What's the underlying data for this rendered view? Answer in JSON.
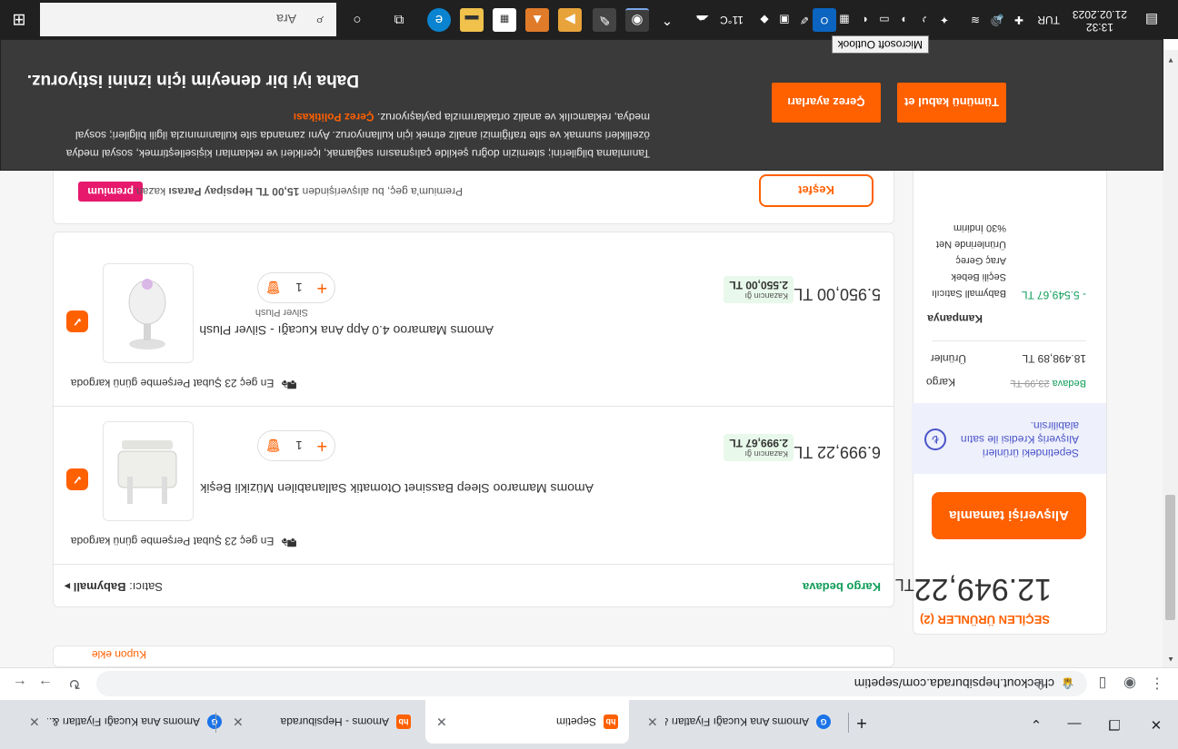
{
  "browser": {
    "tabs": [
      {
        "title": "Amoms Ana Kucağı Fiyatları &...",
        "favicon": "google-icon",
        "active": false
      },
      {
        "title": "Amoms - Hepsiburada",
        "favicon": "hb",
        "active": false
      },
      {
        "title": "Sepetim",
        "favicon": "hb",
        "active": true
      },
      {
        "title": "Amoms Ana Kucağı Fiyatları &...",
        "favicon": "google-icon",
        "active": false
      }
    ],
    "favicon_hb_text": "hb",
    "close_glyph": "✕",
    "new_tab_glyph": "+",
    "url": "checkout.hepsiburada.com/sepetim"
  },
  "cart": {
    "summary": {
      "selected_label": "SEÇİLEN ÜRÜNLER (2)",
      "total_main": "12.949,22",
      "total_currency": "TL",
      "checkout_button": "Alışverişi tamamla",
      "credit_text_1": "Sepetindeki ürünleri",
      "credit_text_2": "Alışveriş Kredisi ile satın",
      "credit_text_3": "alabilirsin.",
      "shipping_label": "Kargo",
      "shipping_value": "Bedava",
      "shipping_struck": "23,99 TL",
      "products_label": "Ürünler",
      "products_value": "18.498,89 TL",
      "campaign_label": "Kampanya",
      "campaign_desc_1": "Babymall Satıcılı",
      "campaign_desc_2": "Seçili Bebek",
      "campaign_desc_3": "Araç Gereç",
      "campaign_desc_4": "Ürünlerinde Net",
      "campaign_desc_5": "%30 İndirim",
      "campaign_value": "- 5.549,67 TL"
    },
    "seller_label": "Satıcı:",
    "seller_name": "Babymall",
    "seller_arrow": "▸",
    "free_shipping": "Kargo bedava",
    "items": [
      {
        "name": "Amoms Mamaroo Sleep Bassinet Otomatik Sallanabilen Müzikli Beşik",
        "variant": "",
        "quantity": "1",
        "price": "6.999,22 TL",
        "savings_label": "Kazancın ğı",
        "savings_value": "2.999,67 TL",
        "shipping": "En geç 23 Şubat Perşembe günü kargoda"
      },
      {
        "name": "Amoms Mamaroo 4.0 App Ana Kucağı - Silver Plush",
        "variant": "Silver Plush",
        "quantity": "1",
        "price": "5.950,00 TL",
        "savings_label": "Kazancın ğı",
        "savings_value": "2.550,00 TL",
        "shipping": "En geç 23 Şubat Perşembe günü kargoda"
      }
    ],
    "premium": {
      "logo": "premium",
      "text_pre": "Premium'a geç, bu alışverişinden ",
      "text_amount": "15,00 TL Hepsipay Parası",
      "text_post": " kazan.",
      "button": "Keşfet"
    },
    "coupon_peek": "Kupon ekle"
  },
  "cookie_banner": {
    "title": "Daha iyi bir deneyim için iznini istiyoruz.",
    "line1": "Tanımlama bilgilerini; sitemizin doğru şekilde çalışmasını sağlamak, içerikleri ve reklamları kişiselleştirmek, sosyal medya",
    "line2": "özellikleri sunmak ve site trafiğimizi analiz etmek için kullanıyoruz. Aynı zamanda site kullanımınızla ilgili bilgileri; sosyal",
    "line3": "medya, reklamcılık ve analiz ortaklarımızla paylaşıyoruz.",
    "policy_link": "Çerez Politikası",
    "btn_settings": "Çerez ayarları",
    "btn_accept": "Tümünü kabul et"
  },
  "taskbar": {
    "search_placeholder": "Ara",
    "tooltip": "Microsoft Outlook",
    "weather": "11°C",
    "lang": "TUR",
    "time": "13:32",
    "date": "21.02.2023"
  },
  "colors": {
    "brand": "#ff6000",
    "credit": "#4a54c9",
    "success": "#0f9d58",
    "premium": "#e6196d"
  }
}
